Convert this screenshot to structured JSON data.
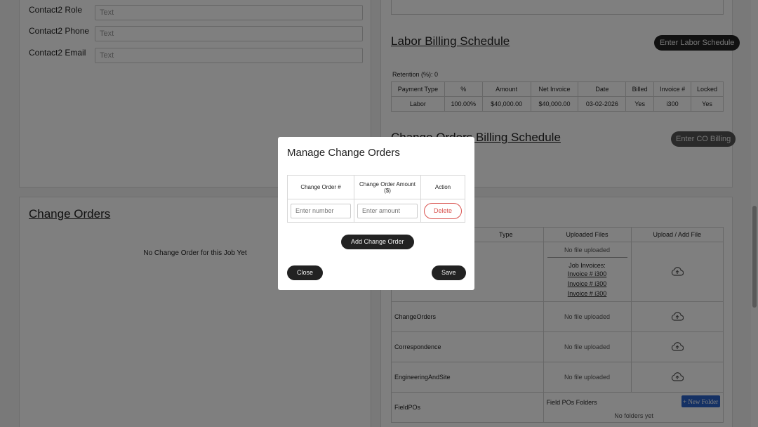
{
  "contact_form": {
    "fields": [
      {
        "label": "Contact2 Role",
        "placeholder": "Text"
      },
      {
        "label": "Contact2 Phone",
        "placeholder": "Text"
      },
      {
        "label": "Contact2 Email",
        "placeholder": "Text"
      }
    ]
  },
  "change_orders_section": {
    "title": "Change Orders",
    "empty_text": "No Change Order for this Job Yet"
  },
  "labor_billing": {
    "title": "Labor Billing Schedule",
    "button": "Enter Labor Schedule",
    "retention": "Retention (%): 0",
    "headers": [
      "Payment Type",
      "%",
      "Amount",
      "Net Invoice",
      "Date",
      "Billed",
      "Invoice #",
      "Locked"
    ],
    "rows": [
      [
        "Labor",
        "100.00%",
        "$40,000.00",
        "$40,000.00",
        "03-02-2026",
        "Yes",
        "i300",
        "Yes"
      ]
    ]
  },
  "co_billing": {
    "title": "Change Orders Billing Schedule",
    "button": "Enter CO Billing"
  },
  "files": {
    "headers": [
      "Type",
      "Uploaded Files",
      "Upload / Add File"
    ],
    "no_file": "No file uploaded",
    "job_invoices_label": "Job Invoices:",
    "invoices": [
      "Invoice # i300",
      "Invoice # i300",
      "Invoice # i300"
    ],
    "rows": [
      {
        "type": "ChangeOrders"
      },
      {
        "type": "Correspondence"
      },
      {
        "type": "EngineeringAndSite"
      },
      {
        "type": "FieldPOs"
      }
    ],
    "field_po_folders_label": "Field POs Folders",
    "new_folder_button": "+ New Folder",
    "no_folders": "No folders yet"
  },
  "modal": {
    "title": "Manage Change Orders",
    "headers": [
      "Change Order #",
      "Change Order Amount ($)",
      "Action"
    ],
    "number_placeholder": "Enter number",
    "amount_placeholder": "Enter amount",
    "delete_button": "Delete",
    "add_button": "Add Change Order",
    "close_button": "Close",
    "save_button": "Save"
  }
}
